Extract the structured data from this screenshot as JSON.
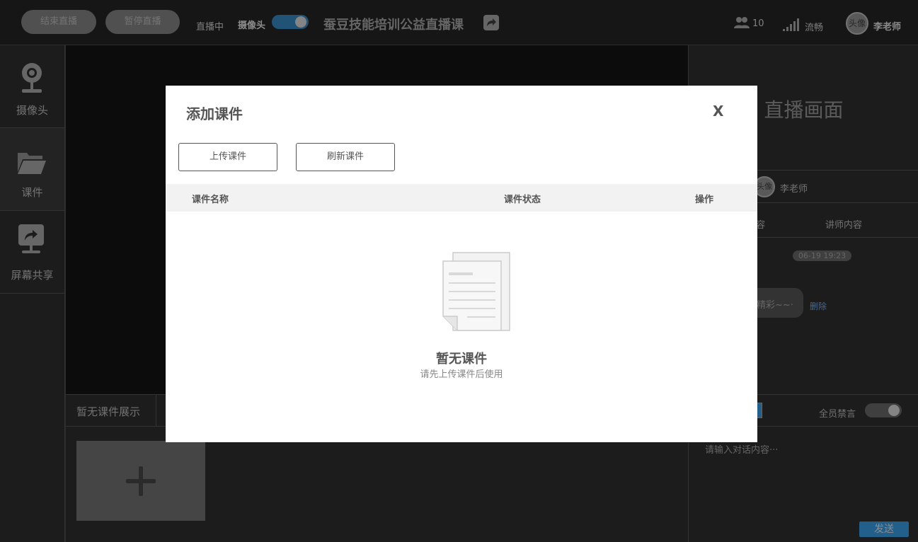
{
  "header": {
    "end_live_label": "结束直播",
    "pause_live_label": "暂停直播",
    "live_status": "直播中",
    "camera_label": "摄像头",
    "title": "蚕豆技能培训公益直播课",
    "viewer_count": "10",
    "network_status": "流畅",
    "avatar_text": "头像",
    "teacher_name": "李老师"
  },
  "sidebar": {
    "items": [
      {
        "label": "摄像头",
        "icon": "webcam-icon"
      },
      {
        "label": "课件",
        "icon": "folder-icon"
      },
      {
        "label": "屏幕共享",
        "icon": "screen-share-icon"
      }
    ]
  },
  "courseware": {
    "empty_label": "暂无课件展示"
  },
  "right_panel": {
    "title": "直播画面",
    "avatar_text": "头像",
    "teacher_name": "李老师",
    "tab_partial": "容",
    "tab_teacher_content": "讲师内容",
    "timestamp": "06-19 19:23",
    "message_partial": "精彩~~·",
    "delete_label": "删除",
    "mute_all_label": "全员禁言",
    "input_placeholder": "请输入对话内容···",
    "send_label": "发送"
  },
  "modal": {
    "title": "添加课件",
    "close_label": "X",
    "upload_label": "上传课件",
    "refresh_label": "刷新课件",
    "columns": [
      "课件名称",
      "课件状态",
      "操作"
    ],
    "empty_title": "暂无课件",
    "empty_subtitle": "请先上传课件后使用"
  },
  "colors": {
    "accent": "#2e7fb8",
    "toggle_on": "#2c6f9e",
    "link": "#5b8cc7"
  }
}
